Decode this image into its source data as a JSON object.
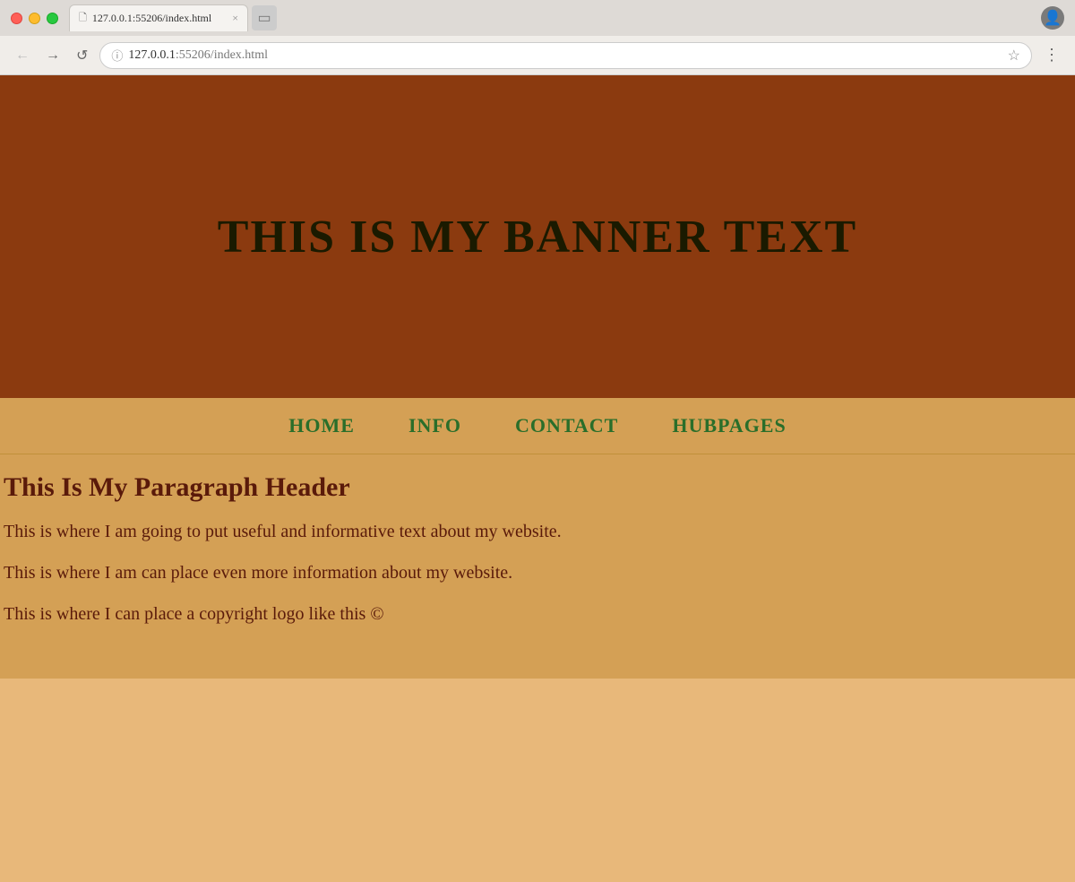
{
  "browser": {
    "url_host": "127.0.0.1",
    "url_path": ":55206/index.html",
    "tab_title": "127.0.0.1:55206/index.html",
    "back_btn": "←",
    "forward_btn": "→",
    "reload_btn": "↺",
    "star_icon": "☆",
    "menu_icon": "⋮",
    "info_icon": "ⓘ",
    "close_icon": "×"
  },
  "website": {
    "banner_text": "THIS IS MY BANNER TEXT",
    "nav": {
      "items": [
        {
          "label": "HOME",
          "id": "home"
        },
        {
          "label": "INFO",
          "id": "info"
        },
        {
          "label": "CONTACT",
          "id": "contact"
        },
        {
          "label": "HUBPAGES",
          "id": "hubpages"
        }
      ]
    },
    "paragraph_header": "This Is My Paragraph Header",
    "paragraphs": [
      "This is where I am going to put useful and informative text about my website.",
      "This is where I am can place even more information about my website.",
      "This is where I can place a copyright logo like this ©"
    ]
  },
  "colors": {
    "banner_bg": "#8B3A0F",
    "nav_bg": "#d4a055",
    "content_bg": "#d4a055",
    "nav_link": "#2a6e2a",
    "text_color": "#5a1a0a"
  }
}
